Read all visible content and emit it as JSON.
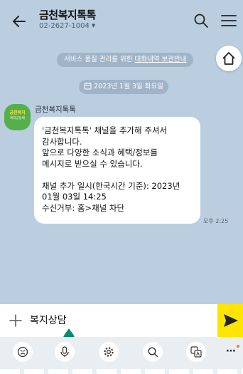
{
  "header": {
    "title": "금천복지톡톡",
    "subtitle": "02-2627-1004"
  },
  "notice": {
    "prefix": "서비스 품질 관리를 위한 ",
    "link": "대화내역 보관안내"
  },
  "date_label": "2023년 1월 3일 화요일",
  "message": {
    "sender": "금천복지톡톡",
    "avatar_text": "금천복지",
    "avatar_sub": "복지공동체",
    "lines": [
      "'금천복지톡톡' 채널을 추가해 주셔서",
      "감사합니다.",
      "앞으로 다양한 소식과 혜택/정보를",
      "메시지로 받으실 수 있습니다.",
      "",
      "채널 추가 일시(한국시간 기준): 2023년",
      "01월 03일 14:25",
      "수신거부: 홈>채널 차단"
    ],
    "time": "오후 2:25"
  },
  "input": {
    "value": "복지상담"
  },
  "colors": {
    "background": "#bacee0",
    "send_button": "#fee500",
    "avatar": "#54b048",
    "notification_dot": "#ff7a1a"
  },
  "icons": [
    "back-arrow-icon",
    "search-icon",
    "hamburger-menu-icon",
    "home-icon",
    "calendar-icon",
    "plus-icon",
    "send-icon",
    "emoji-icon",
    "mic-icon",
    "settings-icon",
    "search-icon",
    "translate-icon",
    "more-icon"
  ]
}
